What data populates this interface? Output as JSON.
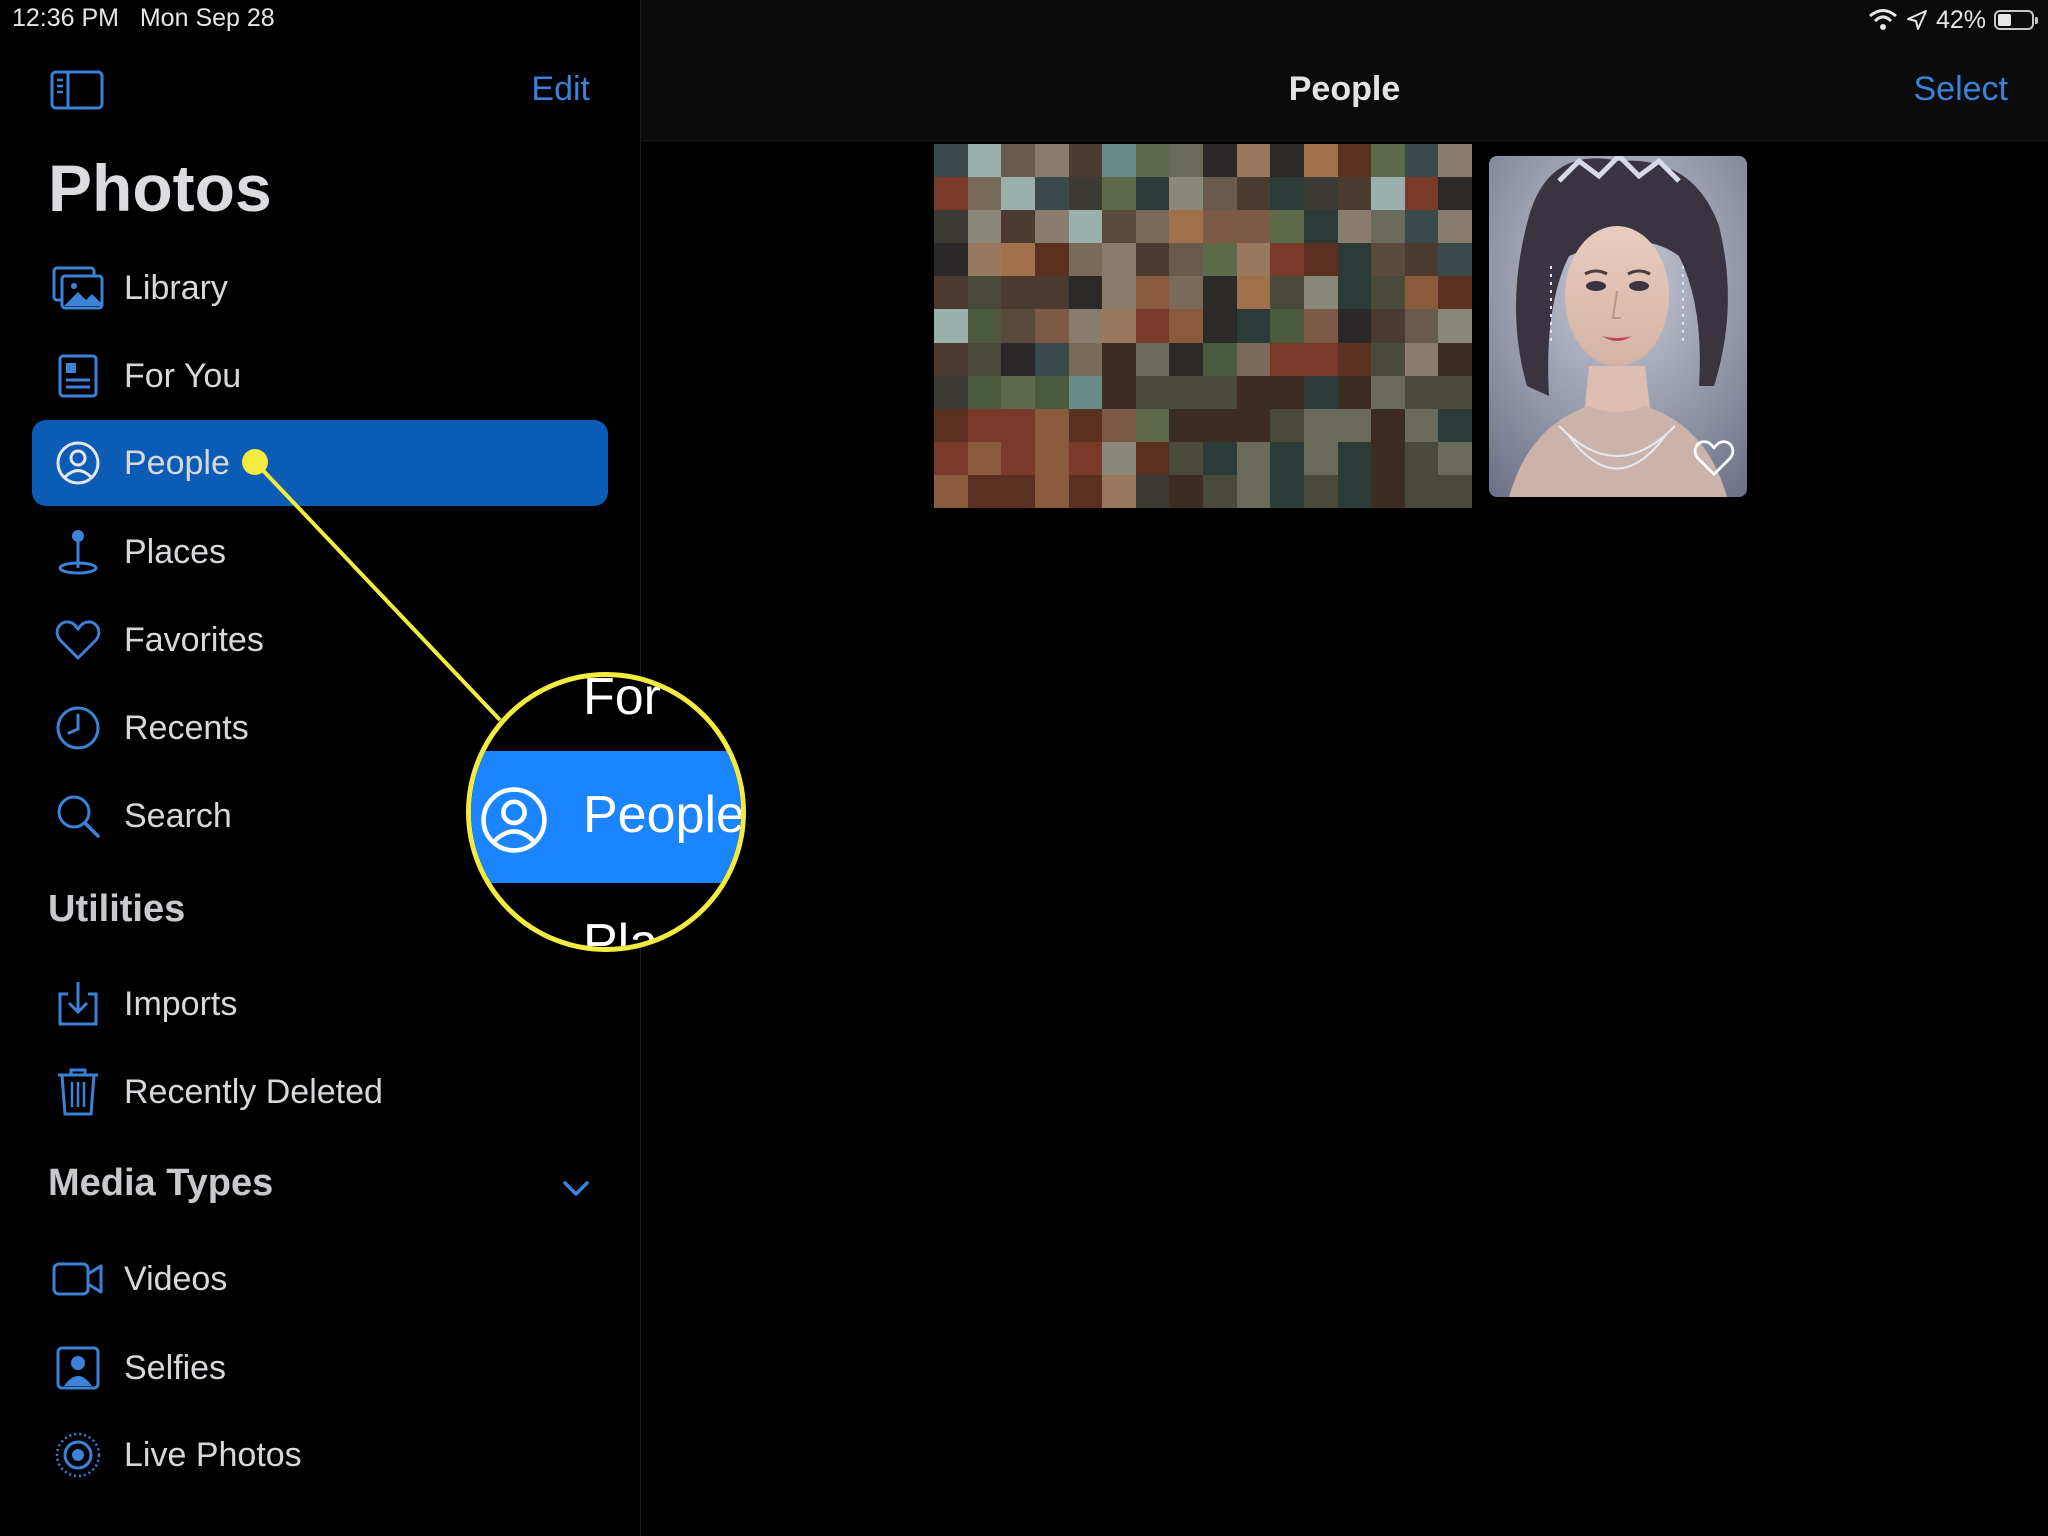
{
  "status_bar": {
    "time": "12:36 PM",
    "date": "Mon Sep 28",
    "battery": "42%",
    "battery_level": 0.42
  },
  "sidebar": {
    "edit_label": "Edit",
    "title": "Photos",
    "items": [
      {
        "label": "Library",
        "icon": "library-icon"
      },
      {
        "label": "For You",
        "icon": "for-you-icon"
      },
      {
        "label": "People",
        "icon": "person-circle-icon",
        "selected": true
      },
      {
        "label": "Places",
        "icon": "map-pin-icon"
      },
      {
        "label": "Favorites",
        "icon": "heart-icon"
      },
      {
        "label": "Recents",
        "icon": "clock-icon"
      },
      {
        "label": "Search",
        "icon": "search-icon"
      }
    ],
    "utilities_header": "Utilities",
    "utilities": [
      {
        "label": "Imports",
        "icon": "import-icon"
      },
      {
        "label": "Recently Deleted",
        "icon": "trash-icon"
      }
    ],
    "media_types_header": "Media Types",
    "media_types": [
      {
        "label": "Videos",
        "icon": "video-icon"
      },
      {
        "label": "Selfies",
        "icon": "selfie-icon"
      },
      {
        "label": "Live Photos",
        "icon": "live-photo-icon"
      }
    ]
  },
  "main": {
    "title": "People",
    "select_label": "Select"
  },
  "callout": {
    "label": "People",
    "above_partial": "For",
    "below_partial": "Places"
  },
  "colors": {
    "accent": "#3b82d8",
    "selected_bg": "#0b5cb5",
    "callout": "#f3ec3f"
  }
}
